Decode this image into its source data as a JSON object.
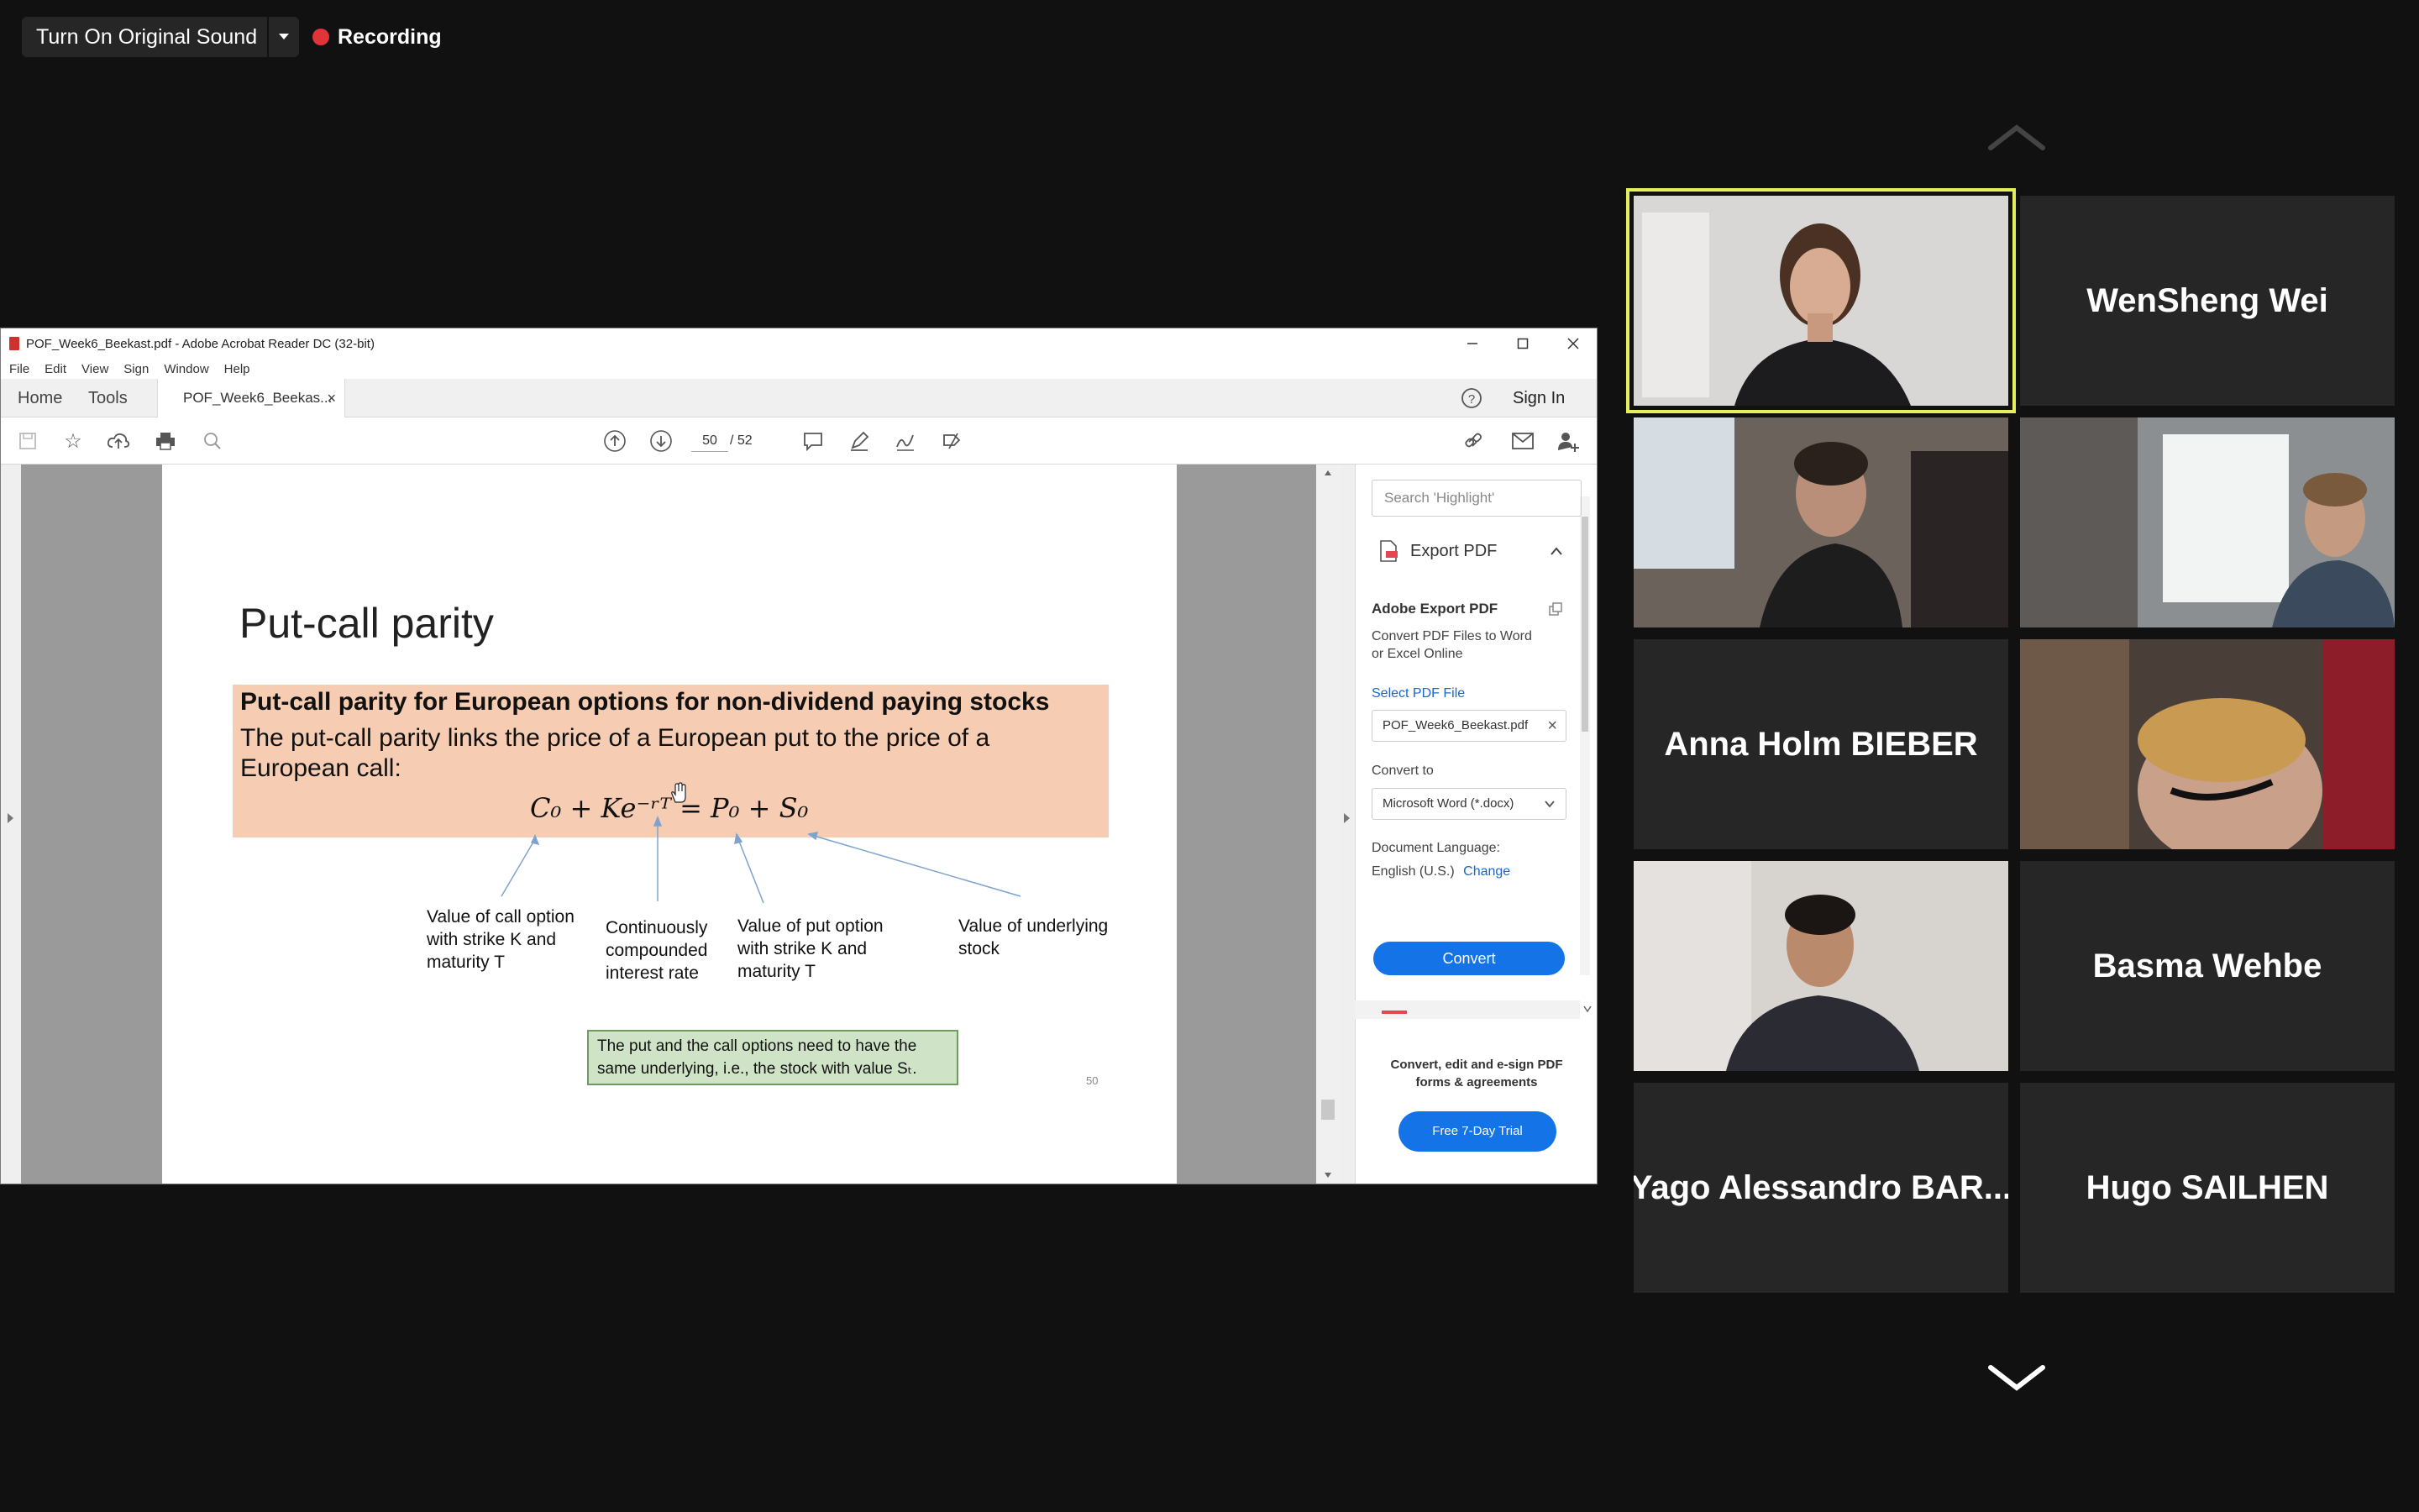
{
  "zoom": {
    "sound_button": "Turn On Original Sound",
    "recording_label": "Recording"
  },
  "acrobat": {
    "window_title": "POF_Week6_Beekast.pdf - Adobe Acrobat Reader DC (32-bit)",
    "menu": [
      "File",
      "Edit",
      "View",
      "Sign",
      "Window",
      "Help"
    ],
    "tabs": {
      "home": "Home",
      "tools": "Tools",
      "document": "POF_Week6_Beekas..."
    },
    "sign_in": "Sign In",
    "page_current": "50",
    "page_total": "/  52"
  },
  "slide": {
    "title": "Put-call parity",
    "def_head": "Put-call parity for European options for non-dividend paying stocks",
    "def_body": "The put-call parity links the price of a European put to the price of a European call:",
    "equation": "C₀ + Ke⁻ʳᵀ = P₀ + S₀",
    "annotations": {
      "call": [
        "Value of call option",
        "with strike K and",
        "maturity T"
      ],
      "rate": [
        "Continuously",
        "compounded",
        "interest rate"
      ],
      "put": [
        "Value of put option",
        "with strike K and",
        "maturity T"
      ],
      "stock": [
        "Value of underlying",
        "stock"
      ]
    },
    "note": [
      "The put and the call options need to have the",
      "same underlying, i.e., the stock with value Sₜ."
    ],
    "page_number": "50"
  },
  "right_panel": {
    "search_placeholder": "Search 'Highlight'",
    "export_label": "Export PDF",
    "adobe_export_title": "Adobe Export PDF",
    "convert_desc": [
      "Convert PDF Files to Word",
      "or Excel Online"
    ],
    "select_file_label": "Select PDF File",
    "file_name": "POF_Week6_Beekast.pdf",
    "convert_to_label": "Convert to",
    "convert_to_value": "Microsoft Word (*.docx)",
    "doc_language_label": "Document Language:",
    "doc_language_value": "English (U.S.)",
    "change_link": "Change",
    "convert_button": "Convert",
    "promo": [
      "Convert, edit and e-sign PDF",
      "forms & agreements"
    ],
    "trial_button": "Free 7-Day Trial"
  },
  "participants": [
    {
      "name": "WenSheng Wei"
    },
    {
      "name": "Anna Holm BIEBER"
    },
    {
      "name": "Basma Wehbe"
    },
    {
      "name": "Yago Alessandro BAR..."
    },
    {
      "name": "Hugo SAILHEN"
    }
  ],
  "colors": {
    "zoom_bg": "#111111",
    "tile_bg": "#262626",
    "active_speaker": "#e4f05a",
    "recording_dot": "#e0333a",
    "adobe_blue": "#1473e6",
    "definition_box": "#f6cdb2",
    "note_box": "#cfe4c6"
  }
}
